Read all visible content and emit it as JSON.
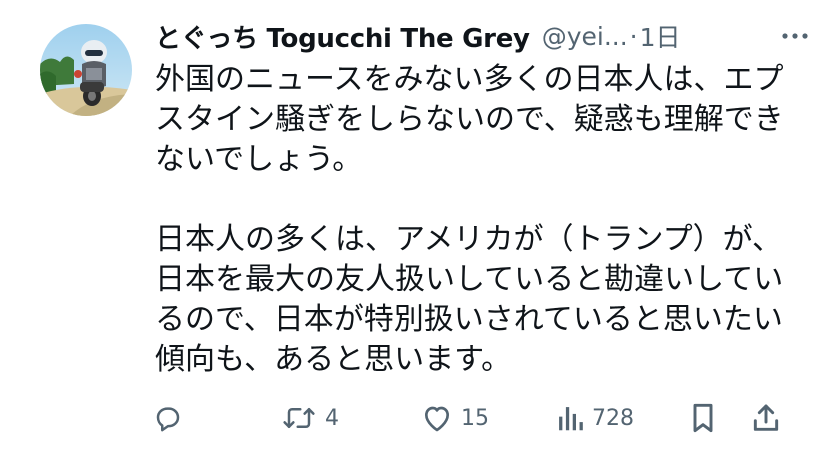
{
  "tweet": {
    "author": {
      "display_name": "とぐっち Togucchi The Grey",
      "handle": "@yei...",
      "avatar_icon": "rider-avatar-icon"
    },
    "separator": "·",
    "timestamp": "1日",
    "more_icon": "more-dots-icon",
    "text_paragraph_1": "外国のニュースをみない多くの日本人は、エプスタイン騒ぎをしらないので、疑惑も理解できないでしょう。",
    "text_paragraph_2": "日本人の多くは、アメリカが（トランプ）が、日本を最大の友人扱いしていると勘違いしているので、日本が特別扱いされていると思いたい傾向も、あると思います。",
    "actions": {
      "reply": {
        "icon": "reply-icon",
        "count": ""
      },
      "retweet": {
        "icon": "retweet-icon",
        "count": "4"
      },
      "like": {
        "icon": "heart-icon",
        "count": "15"
      },
      "views": {
        "icon": "views-chart-icon",
        "count": "728"
      },
      "bookmark": {
        "icon": "bookmark-icon"
      },
      "share": {
        "icon": "share-icon"
      }
    },
    "colors": {
      "text": "#0f1419",
      "secondary": "#536471"
    }
  }
}
